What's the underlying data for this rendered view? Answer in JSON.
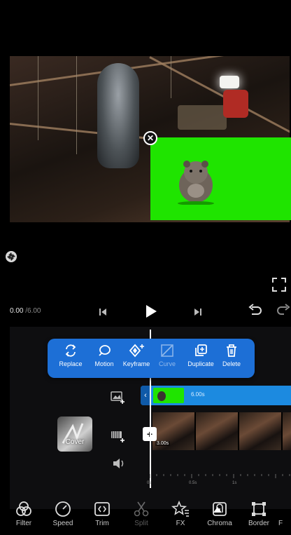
{
  "playback": {
    "current_time": "0.00",
    "separator": "/",
    "total_time": "6.00"
  },
  "popup_menu": {
    "items": [
      {
        "label": "Replace",
        "icon": "replace-icon",
        "enabled": true
      },
      {
        "label": "Motion",
        "icon": "motion-icon",
        "enabled": true
      },
      {
        "label": "Keyframe",
        "icon": "keyframe-icon",
        "enabled": true
      },
      {
        "label": "Curve",
        "icon": "curve-icon",
        "enabled": false
      },
      {
        "label": "Duplicate",
        "icon": "duplicate-icon",
        "enabled": true
      },
      {
        "label": "Delete",
        "icon": "delete-icon",
        "enabled": true
      }
    ]
  },
  "timeline": {
    "overlay_clip_duration": "6.00s",
    "main_clip_duration": "3.00s",
    "cover_label": "Cover",
    "ruler_ticks": [
      "0s",
      "0.5s",
      "1s"
    ]
  },
  "toolbar": {
    "items": [
      {
        "label": "Filter",
        "icon": "filter-icon",
        "enabled": true
      },
      {
        "label": "Speed",
        "icon": "speed-icon",
        "enabled": true
      },
      {
        "label": "Trim",
        "icon": "trim-icon",
        "enabled": true
      },
      {
        "label": "Split",
        "icon": "split-icon",
        "enabled": false
      },
      {
        "label": "FX",
        "icon": "fx-icon",
        "enabled": true
      },
      {
        "label": "Chroma",
        "icon": "chroma-icon",
        "enabled": true
      },
      {
        "label": "Border",
        "icon": "border-icon",
        "enabled": true
      },
      {
        "label": "F",
        "icon": "more-icon",
        "enabled": true
      }
    ]
  },
  "colors": {
    "accent": "#1d6fd6",
    "chroma_green": "#1fe400",
    "overlay_track": "#1c8ae0"
  }
}
